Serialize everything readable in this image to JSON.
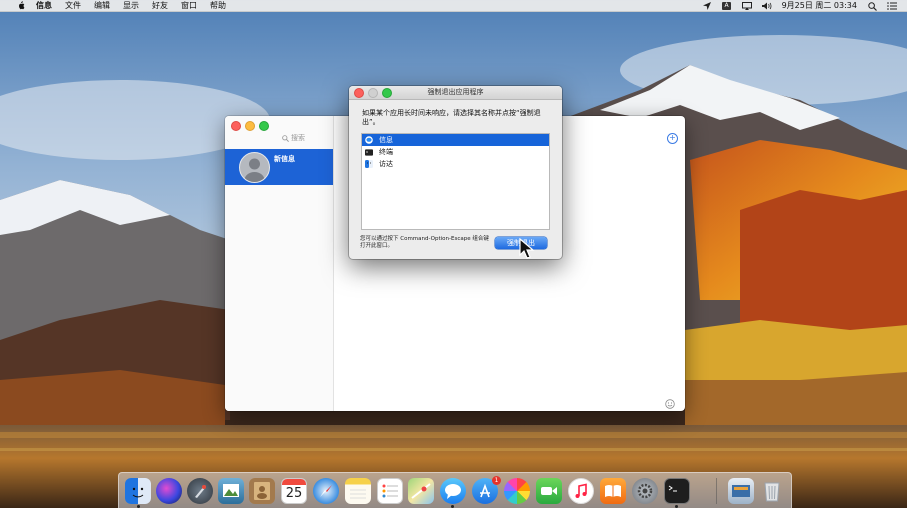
{
  "menubar": {
    "app_name": "信息",
    "menus": [
      "文件",
      "编辑",
      "显示",
      "好友",
      "窗口",
      "帮助"
    ],
    "datetime": "9月25日 周二 03:34",
    "status_icons": [
      "location-icon",
      "input-method-icon",
      "airplay-icon",
      "volume-icon",
      "spotlight-icon",
      "notification-center-icon"
    ],
    "input_method_label": "A"
  },
  "messages_window": {
    "search_placeholder": "搜索",
    "conversations": [
      {
        "title": "新信息"
      }
    ],
    "compose_symbol": "+"
  },
  "force_quit": {
    "title": "强制退出应用程序",
    "message": "如果某个应用长时间未响应，请选择其名称并点按“强制退出”。",
    "apps": [
      {
        "name": "信息",
        "icon": "messages-icon",
        "selected": true
      },
      {
        "name": "终端",
        "icon": "terminal-icon",
        "selected": false
      },
      {
        "name": "访达",
        "icon": "finder-icon",
        "selected": false
      }
    ],
    "hint": "您可以通过按下 Command-Option-Escape 组合键打开此窗口。",
    "button_label": "强制退出"
  },
  "dock": {
    "badge_app_store": "1",
    "calendar_day": "25",
    "apps": [
      "finder-icon",
      "siri-icon",
      "launchpad-icon",
      "preview-icon",
      "contacts-icon",
      "calendar-icon",
      "safari-icon",
      "notes-icon",
      "reminders-icon",
      "maps-icon",
      "messages-icon",
      "app-store-icon",
      "photos-icon",
      "facetime-icon",
      "music-icon",
      "books-icon",
      "system-preferences-icon",
      "terminal-icon",
      "screen-shot-icon",
      "trash-icon"
    ]
  },
  "colors": {
    "accent": "#1d63d6",
    "selection": "#1664d9",
    "close": "#fc605c",
    "minimize": "#fdbc40",
    "zoom": "#34c84a"
  }
}
